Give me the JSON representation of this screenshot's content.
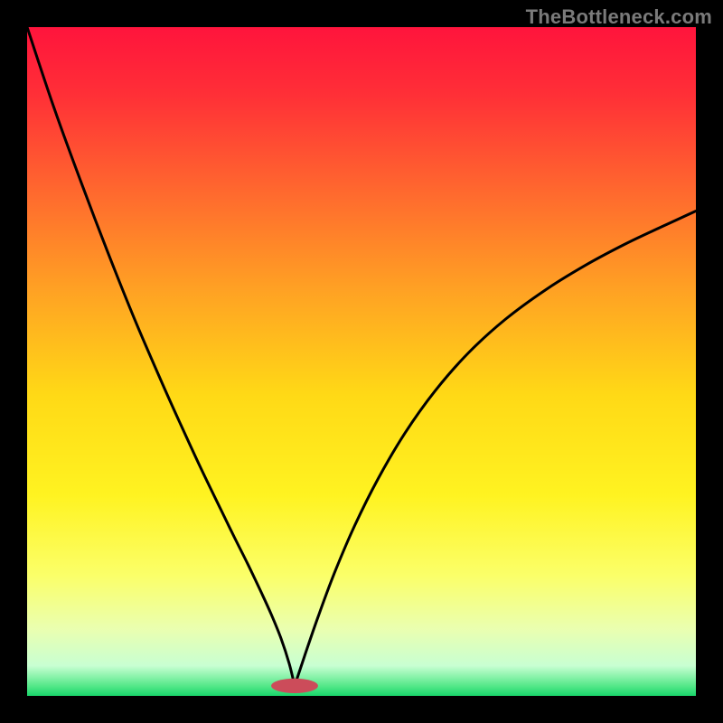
{
  "watermark": "TheBottleneck.com",
  "chart_data": {
    "type": "line",
    "title": "",
    "xlabel": "",
    "ylabel": "",
    "xlim": [
      0,
      1
    ],
    "ylim": [
      0,
      1
    ],
    "gradient_stops": [
      {
        "offset": 0.0,
        "color": "#ff143c"
      },
      {
        "offset": 0.1,
        "color": "#ff2f37"
      },
      {
        "offset": 0.25,
        "color": "#ff6a2e"
      },
      {
        "offset": 0.4,
        "color": "#ffa423"
      },
      {
        "offset": 0.55,
        "color": "#ffd916"
      },
      {
        "offset": 0.7,
        "color": "#fff321"
      },
      {
        "offset": 0.82,
        "color": "#fbff69"
      },
      {
        "offset": 0.9,
        "color": "#eaffb0"
      },
      {
        "offset": 0.955,
        "color": "#c8ffd2"
      },
      {
        "offset": 0.985,
        "color": "#55e889"
      },
      {
        "offset": 1.0,
        "color": "#19d66b"
      }
    ],
    "minimum_x": 0.4,
    "marker": {
      "cx": 0.4,
      "cy": 0.985,
      "rx": 0.035,
      "ry": 0.011,
      "fill": "#cc4c5a"
    },
    "series": [
      {
        "name": "left-branch",
        "x": [
          0.0,
          0.04,
          0.08,
          0.12,
          0.16,
          0.2,
          0.23,
          0.26,
          0.29,
          0.31,
          0.33,
          0.35,
          0.365,
          0.38,
          0.392,
          0.4
        ],
        "y": [
          1.0,
          0.88,
          0.77,
          0.665,
          0.565,
          0.472,
          0.405,
          0.34,
          0.278,
          0.237,
          0.197,
          0.155,
          0.122,
          0.085,
          0.048,
          0.015
        ]
      },
      {
        "name": "right-branch",
        "x": [
          0.4,
          0.415,
          0.435,
          0.46,
          0.49,
          0.525,
          0.565,
          0.61,
          0.66,
          0.715,
          0.775,
          0.835,
          0.895,
          0.95,
          1.0
        ],
        "y": [
          0.015,
          0.06,
          0.118,
          0.185,
          0.255,
          0.325,
          0.393,
          0.456,
          0.513,
          0.563,
          0.607,
          0.644,
          0.676,
          0.702,
          0.725
        ]
      }
    ]
  }
}
